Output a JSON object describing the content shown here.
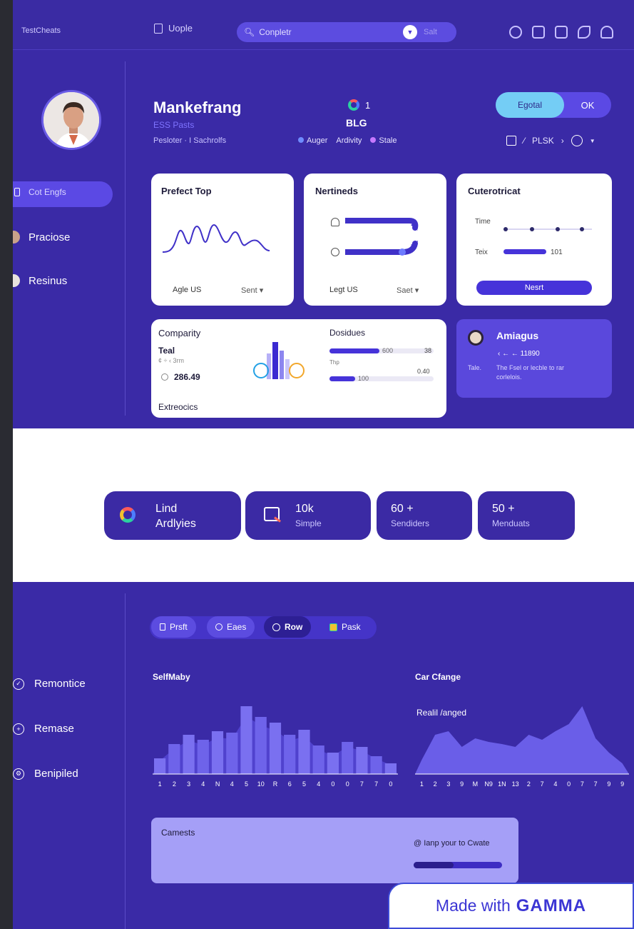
{
  "topbar": {
    "title": "TestCheats",
    "people_label": "Uople",
    "search_value": "Conpletr",
    "search_button": "Salt"
  },
  "sidebar": {
    "items": [
      {
        "label": "Cot Engfs",
        "active": true
      },
      {
        "label": "Praciose"
      },
      {
        "label": "Resinus"
      }
    ]
  },
  "profile": {
    "name": "Mankefrang",
    "subtitle": "ESS Pasts",
    "meta": "Pesloter · I Sachrolfs"
  },
  "header_mid": {
    "count": "1",
    "brand": "BLG",
    "tags": [
      "Auger",
      "Ardivity",
      "Stale"
    ],
    "tag_colors": [
      "#6f8cff",
      "#c678ff"
    ]
  },
  "toggle": {
    "left": "Egotal",
    "right": "OK"
  },
  "breadcrumb": {
    "label": "PLSK"
  },
  "cards": {
    "perfect_top": {
      "title": "Prefect Top",
      "foot_left": "Agle US",
      "foot_right": "Sent"
    },
    "nertinds": {
      "title": "Nertineds",
      "foot_left": "Legt US",
      "foot_right": "Saet"
    },
    "cuterotricat": {
      "title": "Cuterotricat",
      "row1": "Time",
      "row2": "Teix",
      "row2_value": "101",
      "button": "Nesrt",
      "dots_row1": 4,
      "row2_progress": 0.5
    },
    "comparity": {
      "title": "Comparity",
      "sub": "Teal",
      "meta": "¢ ÷ ‹ 3rm",
      "value": "286.49",
      "footer": "Extreocics"
    },
    "dosidues": {
      "title": "Dosidues",
      "row1_value": "600",
      "row1_right": "38",
      "row1_progress": 0.5,
      "mid_label": "Thp",
      "row2_right": "0.40",
      "row2_value": "100",
      "row2_progress": 0.28
    },
    "amiagus": {
      "title": "Amiagus",
      "sub": "‹ ← ← 11890",
      "label": "Tale.",
      "text": "The Fsel or lecble to rar",
      "text2": "corlelois."
    }
  },
  "stats": [
    {
      "big": "Lind",
      "small": "Ardlyies",
      "icon": "ring-chart-icon"
    },
    {
      "big": "10k",
      "small": "Simple",
      "icon": "chart-doc-icon"
    },
    {
      "big": "60 +",
      "small": "Sendiders"
    },
    {
      "big": "50 +",
      "small": "Menduats"
    }
  ],
  "filter_chips": [
    "Prsft",
    "Eaes",
    "Row",
    "Pask"
  ],
  "bottom_sidebar": [
    "Remontice",
    "Remase",
    "Benipiled"
  ],
  "charts": {
    "left": {
      "title": "SelfMaby",
      "x_labels": [
        "1",
        "2",
        "3",
        "4",
        "N",
        "4",
        "5",
        "10",
        "R",
        "6",
        "5",
        "4",
        "0",
        "0",
        "7",
        "7",
        "0"
      ]
    },
    "right": {
      "title": "Car Cfange",
      "subtitle": "Realil /anged",
      "x_labels": [
        "1",
        "2",
        "3",
        "9",
        "M",
        "N9",
        "1N",
        "13",
        "2",
        "7",
        "4",
        "0",
        "7",
        "7",
        "9",
        "9"
      ]
    }
  },
  "chart_data": [
    {
      "type": "bar",
      "title": "SelfMaby",
      "categories": [
        "1",
        "2",
        "3",
        "4",
        "N",
        "4",
        "5",
        "10",
        "R",
        "6",
        "5",
        "4",
        "0",
        "0",
        "7",
        "7",
        "0"
      ],
      "values": [
        22,
        42,
        55,
        48,
        60,
        58,
        95,
        80,
        72,
        55,
        62,
        40,
        30,
        45,
        38,
        25,
        15
      ]
    },
    {
      "type": "area",
      "title": "Car Cfange",
      "categories": [
        "1",
        "2",
        "3",
        "9",
        "M",
        "N9",
        "1N",
        "13",
        "2",
        "7",
        "4",
        "0",
        "7",
        "7",
        "9",
        "9"
      ],
      "values": [
        20,
        55,
        60,
        38,
        50,
        45,
        42,
        38,
        55,
        48,
        60,
        70,
        95,
        50,
        30,
        15
      ]
    }
  ],
  "progress_card": {
    "title": "Camests",
    "text": "@ Ianp your to Cwate",
    "progress": 0.45
  },
  "branding": {
    "made_with": "Made with",
    "brand": "GAMMA"
  }
}
